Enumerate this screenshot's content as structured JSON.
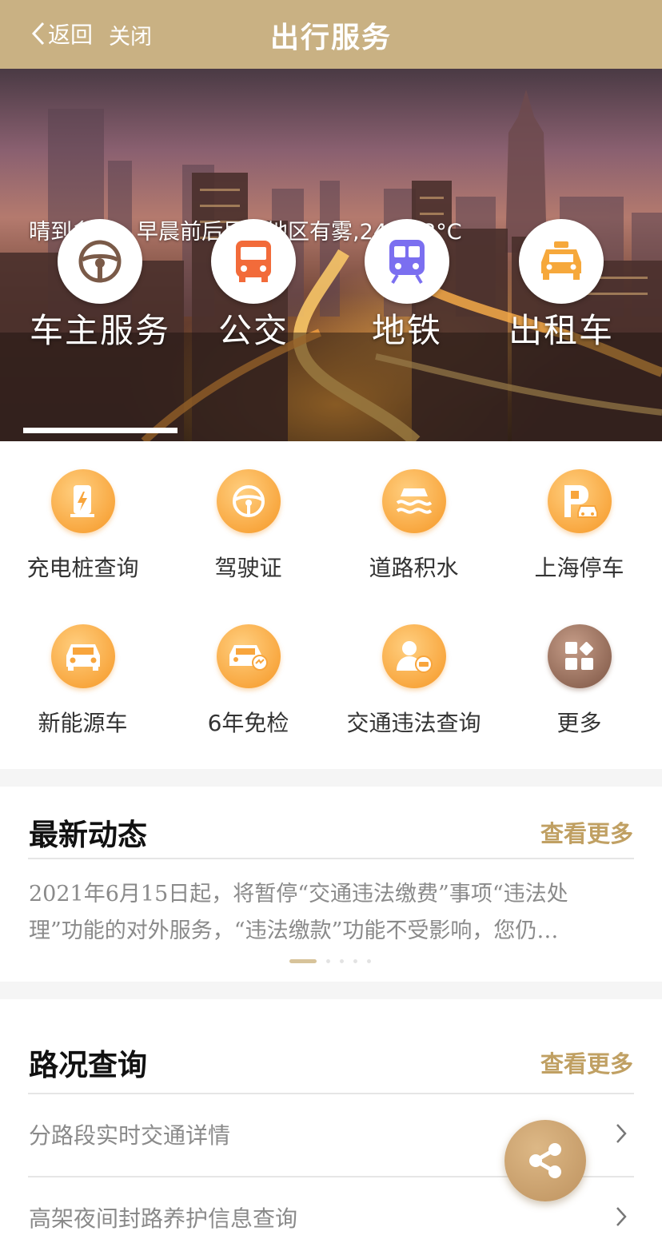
{
  "topbar": {
    "back_label": "返回",
    "close_label": "关闭",
    "title": "出行服务"
  },
  "hero": {
    "weather": "晴到多云，早晨前后局部地区有雾,24～33°C",
    "categories": [
      {
        "label": "车主服务",
        "icon": "steering-wheel-icon",
        "color": "#7a5a48",
        "active": true
      },
      {
        "label": "公交",
        "icon": "bus-icon",
        "color": "#f26b3a",
        "active": false
      },
      {
        "label": "地铁",
        "icon": "subway-icon",
        "color": "#7b6ff0",
        "active": false
      },
      {
        "label": "出租车",
        "icon": "taxi-icon",
        "color": "#f6a83b",
        "active": false
      }
    ]
  },
  "services": [
    {
      "label": "充电桩查询",
      "icon": "charging-pile-icon"
    },
    {
      "label": "驾驶证",
      "icon": "steering-wheel-icon"
    },
    {
      "label": "道路积水",
      "icon": "road-water-icon"
    },
    {
      "label": "上海停车",
      "icon": "parking-icon"
    },
    {
      "label": "新能源车",
      "icon": "car-icon"
    },
    {
      "label": "6年免检",
      "icon": "car-inspection-icon"
    },
    {
      "label": "交通违法查询",
      "icon": "traffic-violation-icon"
    },
    {
      "label": "更多",
      "icon": "more-grid-icon"
    }
  ],
  "news": {
    "title": "最新动态",
    "more_label": "查看更多",
    "text": "2021年6月15日起，将暂停“交通违法缴费”事项“违法处理”功能的对外服务，“违法缴款”功能不受影响，您仍…",
    "pager_count": 5,
    "pager_active": 0
  },
  "traffic": {
    "title": "路况查询",
    "more_label": "查看更多",
    "items": [
      {
        "label": "分路段实时交通详情"
      },
      {
        "label": "高架夜间封路养护信息查询"
      }
    ]
  },
  "colors": {
    "brand": "#c9b183",
    "accent": "#c0a063",
    "service_orange": "#f8a53c"
  }
}
